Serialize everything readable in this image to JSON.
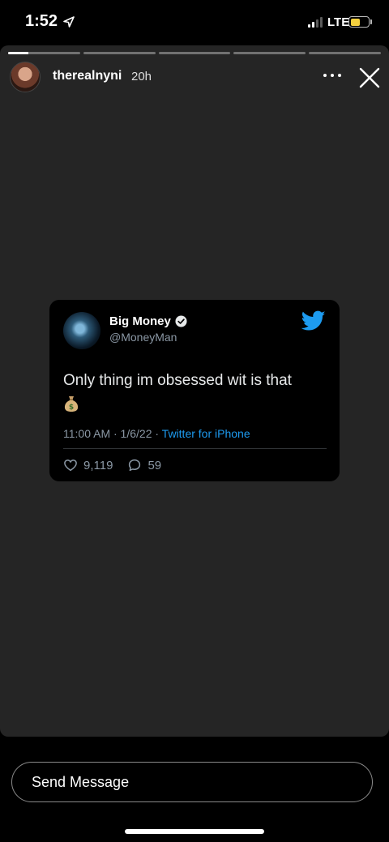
{
  "status_bar": {
    "time": "1:52",
    "network": "LTE",
    "icons": [
      "location-arrow-icon",
      "signal-icon",
      "battery-icon"
    ]
  },
  "story": {
    "username": "therealnyni",
    "time_ago": "20h",
    "segments_total": 5,
    "current_segment_progress": 0.28,
    "icons": [
      "more-icon",
      "close-icon"
    ]
  },
  "tweet": {
    "name": "Big Money",
    "handle": "@MoneyMan",
    "text": "Only thing im obsessed wit is that",
    "time": "11:00 AM · 1/6/22 · ",
    "source": "Twitter for iPhone",
    "likes": "9,119",
    "replies": "59",
    "colors": {
      "accent": "#1d9bf0",
      "background": "#000000",
      "muted": "#8b98a5"
    },
    "icons": [
      "verified-badge-icon",
      "twitter-bird-icon",
      "money-bag-icon",
      "heart-icon",
      "reply-bubble-icon"
    ]
  },
  "bottom": {
    "send_message_placeholder": "Send Message"
  },
  "colors": {
    "story_background": "#252525",
    "app_background": "#000000"
  }
}
